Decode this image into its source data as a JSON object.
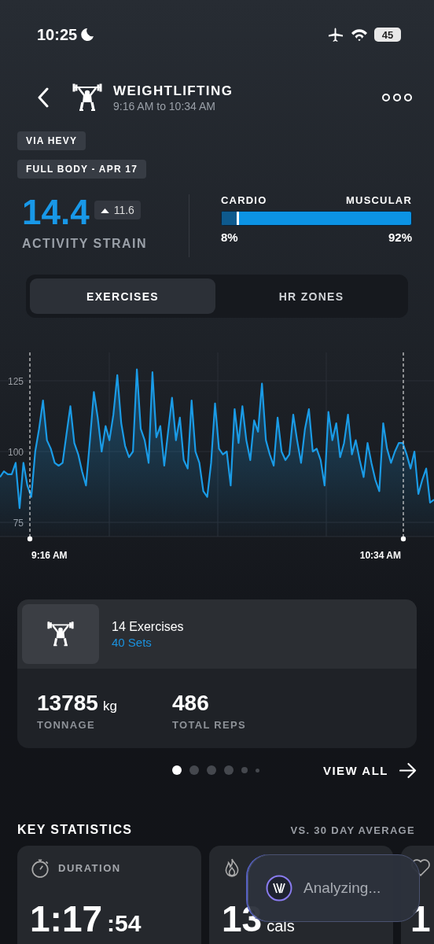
{
  "status_bar": {
    "time": "10:25",
    "battery": "45"
  },
  "header": {
    "title": "WEIGHTLIFTING",
    "subtitle": "9:16 AM to 10:34 AM"
  },
  "chips": [
    "VIA HEVY",
    "FULL BODY - APR 17"
  ],
  "strain": {
    "value": "14.4",
    "change": "11.6",
    "label": "ACTIVITY STRAIN"
  },
  "split": {
    "left_label": "CARDIO",
    "right_label": "MUSCULAR",
    "level": 0.08,
    "left_value": "8%",
    "right_value": "92%"
  },
  "tabs": [
    {
      "label": "EXERCISES",
      "selected": true
    },
    {
      "label": "HR ZONES",
      "selected": false
    }
  ],
  "time_markers": [
    "9:16 AM",
    "10:34 AM"
  ],
  "chart_data": {
    "type": "area",
    "grid": true,
    "ylim": [
      70,
      135
    ],
    "yticks": [
      75,
      100,
      125
    ],
    "series": [
      {
        "color": "#1a9be6",
        "values": [
          91,
          93,
          92,
          92,
          96,
          80,
          96,
          88,
          84,
          100,
          108,
          118,
          104,
          101,
          96,
          95,
          96,
          106,
          116,
          103,
          99,
          93,
          88,
          104,
          121,
          112,
          100,
          109,
          104,
          113,
          127,
          110,
          102,
          98,
          100,
          129,
          108,
          104,
          96,
          128,
          105,
          109,
          95,
          107,
          119,
          104,
          112,
          97,
          94,
          118,
          100,
          96,
          86,
          84,
          96,
          117,
          101,
          99,
          100,
          88,
          115,
          103,
          116,
          104,
          97,
          111,
          107,
          124,
          104,
          99,
          95,
          112,
          100,
          97,
          99,
          113,
          104,
          96,
          108,
          115,
          100,
          101,
          97,
          88,
          114,
          104,
          110,
          98,
          103,
          113,
          99,
          104,
          97,
          91,
          103,
          96,
          90,
          86,
          110,
          101,
          96,
          100,
          103,
          103,
          99,
          94,
          100,
          85,
          90,
          94,
          82,
          83
        ]
      }
    ]
  },
  "summary": {
    "title": "14 Exercises",
    "sets": "40 Sets",
    "stats": [
      {
        "value": "13785",
        "unit": "kg",
        "label": "TONNAGE"
      },
      {
        "value": "486",
        "label": "TOTAL REPS"
      }
    ]
  },
  "pages": [
    {
      "selected": true
    },
    {
      "selected": false
    },
    {
      "selected": false
    },
    {
      "selected": false
    },
    {
      "selected": false
    },
    {
      "selected": false
    }
  ],
  "view_all": "VIEW ALL",
  "key_stats": {
    "title": "KEY STATISTICS",
    "compare": "VS. 30 DAY AVERAGE",
    "cards": [
      {
        "kind": "duration",
        "label": "DURATION",
        "value": "1:17",
        "sub": ":54"
      },
      {
        "kind": "calories",
        "value": "13",
        "unit": "cals"
      },
      {
        "kind": "heart",
        "value": "1"
      }
    ]
  },
  "toast": {
    "text": "Analyzing..."
  }
}
